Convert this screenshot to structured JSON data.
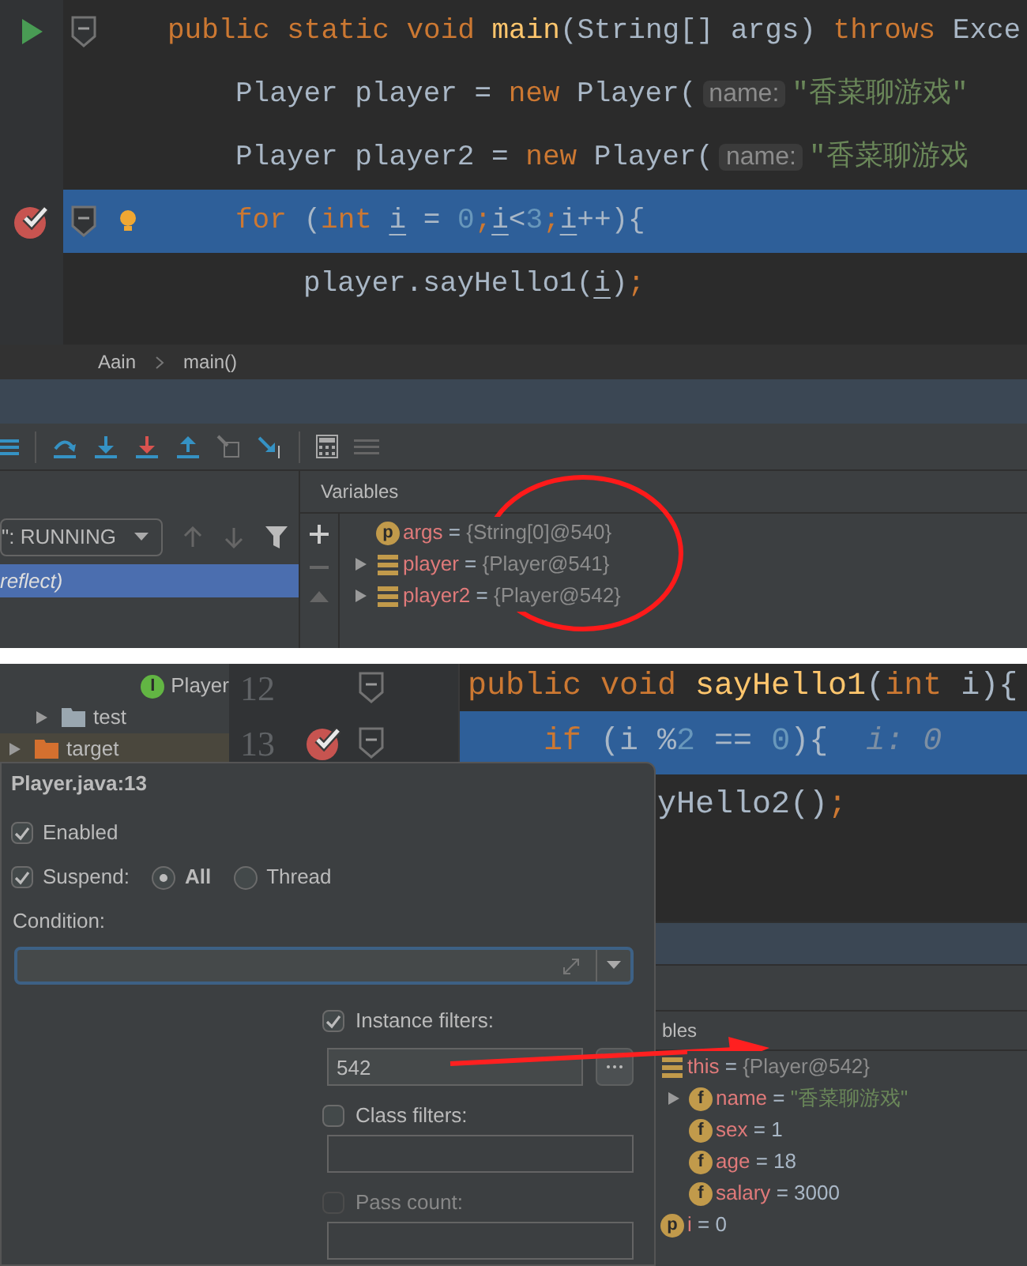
{
  "editor_top": {
    "lines": [
      {
        "run": true,
        "breakpoint": false,
        "fold": true,
        "selected": false,
        "tokens": [
          {
            "kind": "keyword",
            "text": "public static void "
          },
          {
            "kind": "method",
            "text": "main"
          },
          {
            "kind": "plain",
            "text": "(String[] args) "
          },
          {
            "kind": "keyword",
            "text": "throws "
          },
          {
            "kind": "plain",
            "text": "Exce"
          }
        ],
        "children": [
          {
            "run": false,
            "breakpoint": false,
            "fold": false,
            "selected": false,
            "tokens": [
              {
                "kind": "plain",
                "text": "Player player = "
              },
              {
                "kind": "keyword",
                "text": "new "
              },
              {
                "kind": "plain",
                "text": "Player("
              },
              {
                "kind": "hint",
                "text": "name:"
              },
              {
                "kind": "string",
                "text": "\"香菜聊游戏\""
              }
            ]
          },
          {
            "run": false,
            "breakpoint": false,
            "fold": false,
            "selected": false,
            "tokens": [
              {
                "kind": "plain",
                "text": "Player player2 = "
              },
              {
                "kind": "keyword",
                "text": "new "
              },
              {
                "kind": "plain",
                "text": "Player("
              },
              {
                "kind": "hint",
                "text": "name:"
              },
              {
                "kind": "string",
                "text": "\"香菜聊游戏"
              }
            ]
          },
          {
            "run": false,
            "breakpoint": true,
            "fold": true,
            "bulb": true,
            "selected": true,
            "tokens": [
              {
                "kind": "keyword",
                "text": "for"
              },
              {
                "kind": "plain",
                "text": " ("
              },
              {
                "kind": "keyword",
                "text": "int "
              },
              {
                "kind": "variable",
                "text": "i"
              },
              {
                "kind": "plain",
                "text": " = "
              },
              {
                "kind": "number",
                "text": "0"
              },
              {
                "kind": "keyword",
                "text": ";"
              },
              {
                "kind": "variable",
                "text": "i"
              },
              {
                "kind": "plain",
                "text": "<"
              },
              {
                "kind": "number",
                "text": "3"
              },
              {
                "kind": "keyword",
                "text": ";"
              },
              {
                "kind": "variable",
                "text": "i"
              },
              {
                "kind": "plain",
                "text": "++){"
              }
            ],
            "children": [
              {
                "run": false,
                "breakpoint": false,
                "fold": false,
                "selected": false,
                "tokens": [
                  {
                    "kind": "plain",
                    "text": "player.sayHello1("
                  },
                  {
                    "kind": "variable",
                    "text": "i"
                  },
                  {
                    "kind": "plain",
                    "text": ")"
                  },
                  {
                    "kind": "keyword",
                    "text": ";"
                  }
                ]
              }
            ]
          }
        ]
      }
    ]
  },
  "breadcrumbs": [
    "Aain",
    "main()"
  ],
  "debugger": {
    "thread_dropdown": "\": RUNNING",
    "frames": [
      {
        "label": "reflect)",
        "selected": true
      }
    ],
    "variables_title": "Variables",
    "variables": [
      {
        "badge": "p",
        "name": "args",
        "equals": "=",
        "value": "{String[0]@540}",
        "kind": "reference",
        "expandable": false
      },
      {
        "name": "player",
        "equals": "=",
        "value": "{Player@541}",
        "kind": "reference",
        "expandable": true
      },
      {
        "name": "player2",
        "equals": "=",
        "value": "{Player@542}",
        "kind": "reference",
        "expandable": true
      }
    ]
  },
  "bottom": {
    "tree": [
      {
        "children": [
          {
            "children": [
              {
                "children": [
                  {
                    "children": [
                      {
                        "label": "Player",
                        "badge": "I",
                        "kind": "class",
                        "expandable": false
                      }
                    ]
                  }
                ]
              }
            ]
          },
          {
            "label": "test",
            "kind": "folder",
            "expandable": true
          }
        ]
      },
      {
        "label": "target",
        "kind": "excluded-folder",
        "expandable": true
      }
    ],
    "editor": {
      "lines": [
        {
          "number": "12",
          "breakpoint": false,
          "fold": true,
          "selected": false,
          "tokens": [
            {
              "kind": "keyword",
              "text": "public void "
            },
            {
              "kind": "method",
              "text": "sayHello1"
            },
            {
              "kind": "plain",
              "text": "("
            },
            {
              "kind": "keyword",
              "text": "int "
            },
            {
              "kind": "plain",
              "text": "i){"
            }
          ],
          "children": [
            {
              "number": "13",
              "breakpoint": true,
              "fold": true,
              "selected": true,
              "tokens": [
                {
                  "kind": "keyword",
                  "text": "if "
                },
                {
                  "kind": "plain",
                  "text": "(i %"
                },
                {
                  "kind": "number",
                  "text": "2"
                },
                {
                  "kind": "plain",
                  "text": " == "
                },
                {
                  "kind": "number",
                  "text": "0"
                },
                {
                  "kind": "plain",
                  "text": "){"
                },
                {
                  "kind": "inline",
                  "text": "i: 0"
                }
              ],
              "children": [
                {
                  "covered": true,
                  "selected": false,
                  "tokens": [
                    {
                      "kind": "plain",
                      "text": "yHello2()"
                    },
                    {
                      "kind": "keyword",
                      "text": ";"
                    }
                  ]
                }
              ]
            }
          ]
        }
      ]
    },
    "breakpoint_popup": {
      "title": "Player.java:13",
      "enabled": {
        "label": "Enabled",
        "checked": true
      },
      "suspend": {
        "label": "Suspend:",
        "checked": true,
        "options": [
          {
            "label": "All",
            "selected": true
          },
          {
            "label": "Thread",
            "selected": false
          }
        ]
      },
      "condition": {
        "label": "Condition:",
        "focused": true
      },
      "filters": [
        {
          "label": "Instance filters:",
          "checked": true,
          "disabled": false,
          "value": "542",
          "kind": "browse"
        },
        {
          "label": "Class filters:",
          "checked": false,
          "disabled": false,
          "kind": "folder"
        },
        {
          "label": "Pass count:",
          "checked": false,
          "disabled": true,
          "kind": "plain"
        }
      ]
    },
    "variables_title": "bles",
    "variables": [
      {
        "name": "this",
        "equals": "=",
        "value": "{Player@542}",
        "kind": "reference",
        "children": [
          {
            "badge": "f",
            "name": "name",
            "equals": "=",
            "value": "\"香菜聊游戏\"",
            "kind": "string",
            "expandable": true
          },
          {
            "badge": "f",
            "name": "sex",
            "equals": "=",
            "value": "1",
            "kind": "number",
            "expandable": false
          },
          {
            "badge": "f",
            "name": "age",
            "equals": "=",
            "value": "18",
            "kind": "number",
            "expandable": false
          },
          {
            "badge": "f",
            "name": "salary",
            "equals": "=",
            "value": "3000",
            "kind": "number",
            "expandable": false
          }
        ]
      },
      {
        "badge": "p",
        "name": "i",
        "equals": "=",
        "value": "0",
        "kind": "number"
      }
    ]
  }
}
